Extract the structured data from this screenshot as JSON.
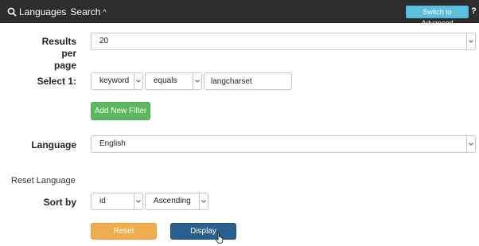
{
  "header": {
    "title": "Languages",
    "subtitle": "Search",
    "chevron": "^",
    "advanced_button": "Switch to Advanced",
    "help": "?"
  },
  "results_per_page": {
    "label_line1": "Results per",
    "label_line2": "page",
    "value": "20"
  },
  "filter": {
    "label": "Select 1:",
    "field": "keyword",
    "operator": "equals",
    "value": "langcharset",
    "add_button": "Add New Filter"
  },
  "language": {
    "label": "Language",
    "value": "English"
  },
  "reset_language": "Reset Language",
  "sort": {
    "label": "Sort by",
    "field": "id",
    "direction": "Ascending"
  },
  "actions": {
    "reset": "Reset",
    "display": "Display"
  },
  "colors": {
    "header_bg": "#2d2d2d",
    "info": "#5bc0de",
    "success": "#5cb85c",
    "warning": "#f0ad4e",
    "primary": "#2b5f8e"
  }
}
